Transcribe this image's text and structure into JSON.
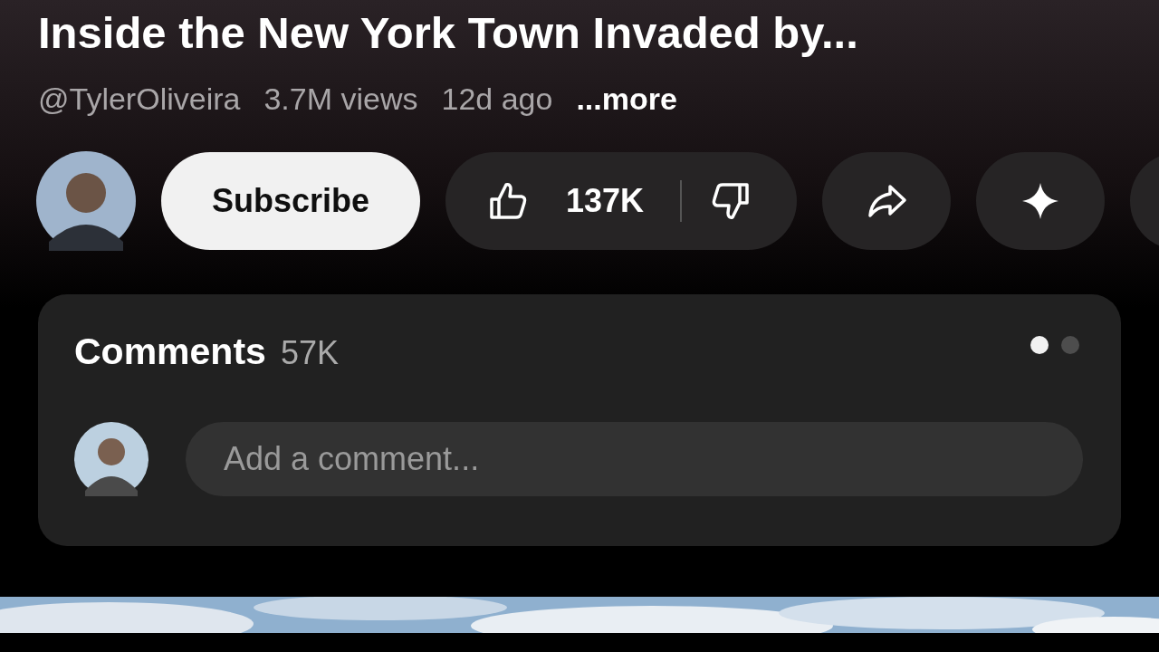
{
  "video": {
    "title": "Inside the New York Town Invaded by...",
    "channel": "@TylerOliveira",
    "views": "3.7M views",
    "age": "12d ago",
    "more": "...more"
  },
  "actions": {
    "subscribe": "Subscribe",
    "likes": "137K"
  },
  "comments": {
    "title": "Comments",
    "count": "57K",
    "placeholder": "Add a comment...",
    "pages": [
      {
        "selected": true
      },
      {
        "selected": false
      }
    ]
  }
}
